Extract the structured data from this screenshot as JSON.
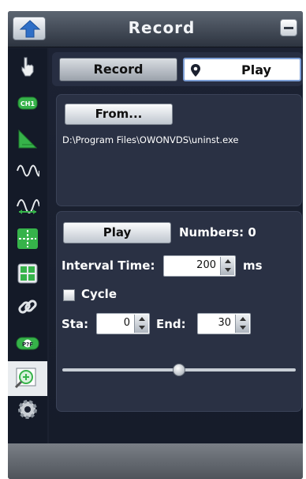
{
  "window": {
    "title": "Record"
  },
  "tabs": {
    "record": "Record",
    "play": "Play"
  },
  "record_source": {
    "from_label": "From...",
    "path": "D:\\Program Files\\OWONVDS\\uninst.exe"
  },
  "player": {
    "play_label": "Play",
    "numbers_label": "Numbers:",
    "numbers_value": "0",
    "interval_label": "Interval Time:",
    "interval_value": "200",
    "interval_unit": "ms",
    "cycle_label": "Cycle",
    "cycle_checked": false,
    "sta_label": "Sta:",
    "sta_value": "0",
    "end_label": "End:",
    "end_value": "30",
    "slider_fraction": 0.5
  },
  "sidebar": {
    "items": [
      {
        "icon": "hand-pointer-icon"
      },
      {
        "icon": "channel-ch1-icon",
        "text": "CH1"
      },
      {
        "icon": "triangle-trigger-icon"
      },
      {
        "icon": "sine-wave-icon"
      },
      {
        "icon": "wave-measure-icon"
      },
      {
        "icon": "cursor-crosshair-icon"
      },
      {
        "icon": "calculator-math-icon"
      },
      {
        "icon": "link-chain-icon"
      },
      {
        "icon": "pass-fail-icon",
        "text": "P?F"
      },
      {
        "icon": "record-zoom-icon",
        "active": true
      },
      {
        "icon": "settings-gear-icon"
      }
    ]
  },
  "colors": {
    "background": "#1b2130",
    "panel": "#2a3144",
    "accent": "#7d9fd6",
    "icon_green": "#36b34a"
  }
}
